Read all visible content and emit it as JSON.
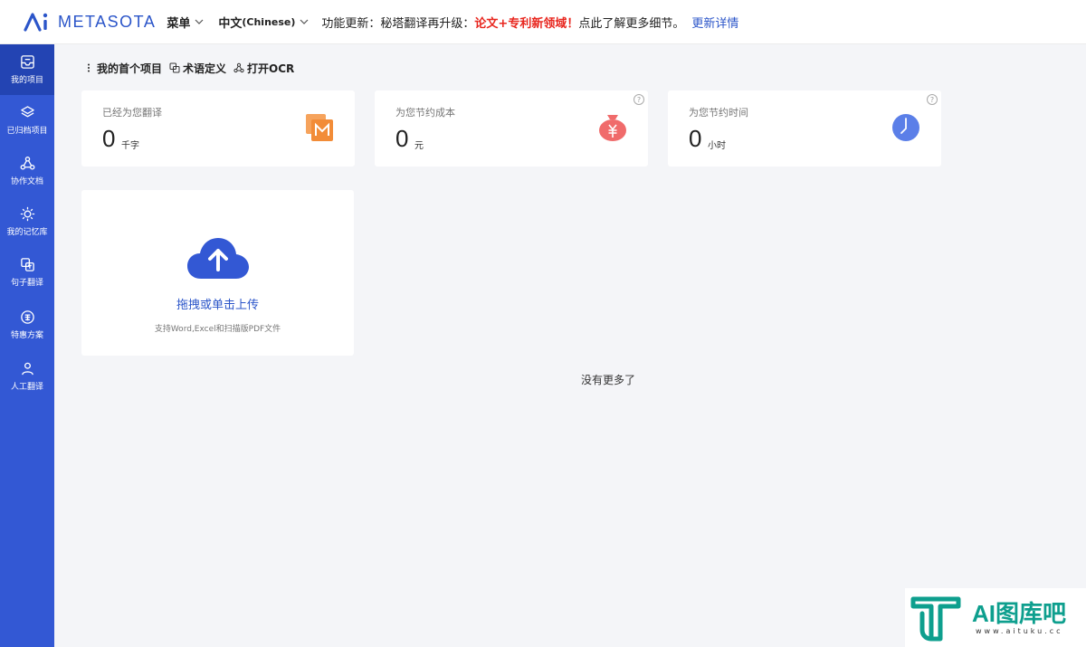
{
  "header": {
    "brand": "METASOTA",
    "menu_label": "菜单",
    "lang_label": "中文",
    "lang_sub": "(Chinese)",
    "notice_prefix": "功能更新：秘塔翻译再升级：",
    "notice_highlight": "论文+专利新领域！",
    "notice_suffix": "点此了解更多细节。",
    "notice_link": "更新详情"
  },
  "sidebar": {
    "items": [
      {
        "label": "我的项目",
        "icon": "inbox-icon"
      },
      {
        "label": "已归档项目",
        "icon": "layers-icon"
      },
      {
        "label": "协作文档",
        "icon": "collab-icon"
      },
      {
        "label": "我的记忆库",
        "icon": "bulb-icon"
      },
      {
        "label": "句子翻译",
        "icon": "translate-icon"
      },
      {
        "label": "特惠方案",
        "icon": "discount-icon"
      },
      {
        "label": "人工翻译",
        "icon": "person-icon"
      }
    ]
  },
  "projbar": {
    "project": "我的首个项目",
    "glossary": "术语定义",
    "ocr": "打开OCR"
  },
  "stats": {
    "translated": {
      "label": "已经为您翻译",
      "value": "0",
      "unit": "千字"
    },
    "cost": {
      "label": "为您节约成本",
      "value": "0",
      "unit": "元",
      "help": "?"
    },
    "time": {
      "label": "为您节约时间",
      "value": "0",
      "unit": "小时",
      "help": "?"
    }
  },
  "upload": {
    "title": "拖拽或单击上传",
    "subtitle": "支持Word,Excel和扫描版PDF文件"
  },
  "no_more": "没有更多了",
  "watermark": {
    "title": "AI图库吧",
    "url": "www.aituku.cc"
  },
  "colors": {
    "brand": "#3358d4",
    "highlight": "#e8261e",
    "link": "#2b55c9"
  }
}
